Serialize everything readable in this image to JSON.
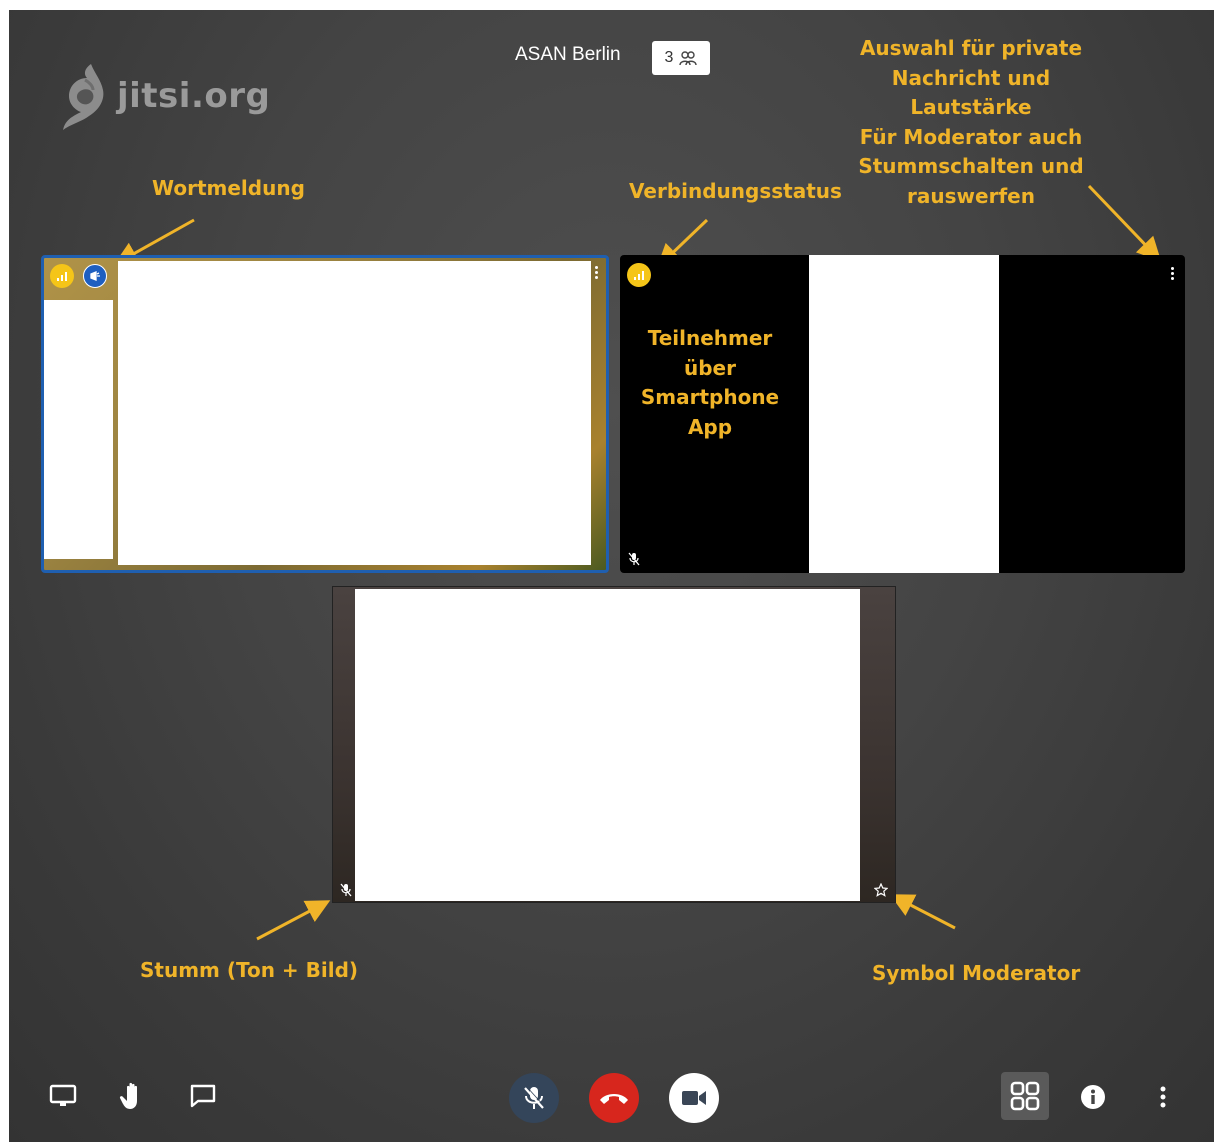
{
  "header": {
    "logo_text": "jitsi.org",
    "room_name": "ASAN Berlin",
    "participant_count": "3"
  },
  "annotations": {
    "wortmeldung": "Wortmeldung",
    "verbindungsstatus": "Verbindungsstatus",
    "auswahl": [
      "Auswahl für private",
      "Nachricht und",
      "Lautstärke",
      "Für Moderator auch",
      "Stummschalten und",
      "rauswerfen"
    ],
    "teilnehmer": [
      "Teilnehmer",
      "über",
      "Smartphone",
      "App"
    ],
    "stumm": "Stumm (Ton + Bild)",
    "symbol_moderator": "Symbol Moderator"
  },
  "colors": {
    "annotation": "#f0b429",
    "active_speaker_border": "#1f5fb0",
    "hangup": "#d7261d",
    "connection_good": "#f5c518"
  },
  "toolbar": {
    "left": [
      "screen-share-icon",
      "raise-hand-icon",
      "chat-icon"
    ],
    "center": [
      "mic-muted-icon",
      "hangup-icon",
      "camera-icon"
    ],
    "right": [
      "tile-view-icon",
      "info-icon",
      "more-vertical-icon"
    ]
  }
}
